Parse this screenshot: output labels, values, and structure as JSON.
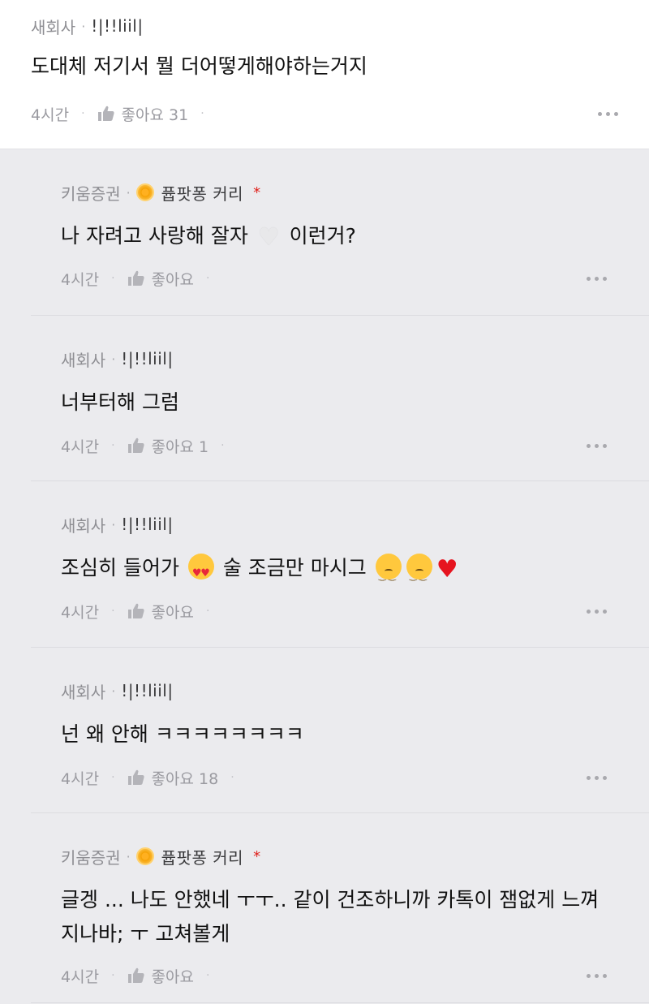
{
  "top_comment": {
    "author": "새회사",
    "nickname": "!|!!liil|",
    "body": "도대체 저기서 뭘 더어떻게해야하는거지",
    "time": "4시간",
    "like_label": "좋아요 31"
  },
  "replies": [
    {
      "author": "키움증권",
      "badge_name": "퓹팟퐁 커리",
      "badge_star": "*",
      "body_parts": [
        "나 자려고 사랑해 잘자",
        "이런거?"
      ],
      "time": "4시간",
      "like_label": "좋아요"
    },
    {
      "author": "새회사",
      "nickname": "!|!!liil|",
      "body": "너부터해 그럼",
      "time": "4시간",
      "like_label": "좋아요 1"
    },
    {
      "author": "새회사",
      "nickname": "!|!!liil|",
      "body_parts": [
        "조심히 들어가",
        "술 조금만 마시그"
      ],
      "time": "4시간",
      "like_label": "좋아요"
    },
    {
      "author": "새회사",
      "nickname": "!|!!liil|",
      "body": "넌 왜 안해 ㅋㅋㅋㅋㅋㅋㅋㅋ",
      "time": "4시간",
      "like_label": "좋아요 18"
    },
    {
      "author": "키움증권",
      "badge_name": "퓹팟퐁 커리",
      "badge_star": "*",
      "body_line1": "글겡 ... 나도 안했네 ㅜㅜ.. 같이 건조하니까 카톡이 잼없게 느껴",
      "body_line2": "지나바; ㅜ 고쳐볼게",
      "time": "4시간",
      "like_label": "좋아요"
    }
  ],
  "separator_dot": "·",
  "icons": {
    "like": "thumbs-up-icon",
    "more": "more-horizontal-icon",
    "badge": "flower-badge-icon"
  },
  "colors": {
    "background": "#ebebee",
    "top_background": "#ffffff",
    "meta_text": "#8e8e93",
    "accent_star": "#e0221d"
  }
}
